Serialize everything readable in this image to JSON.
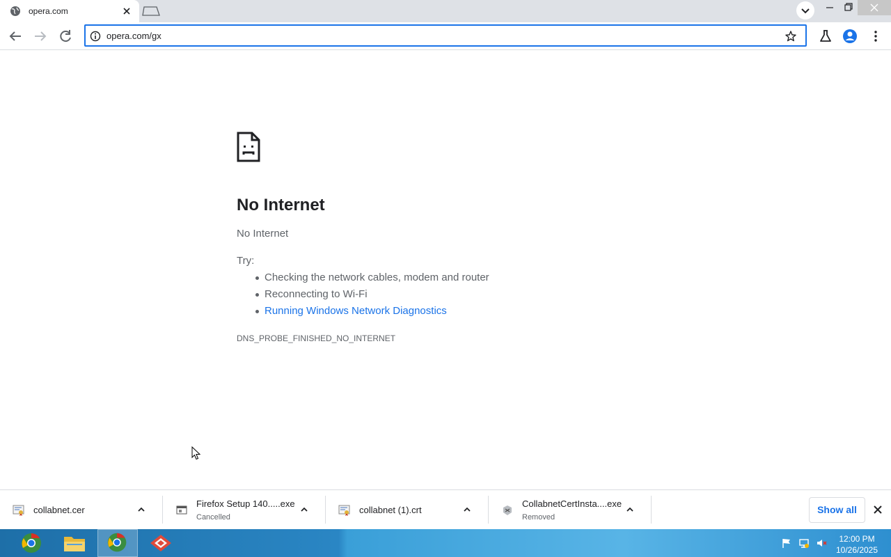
{
  "browser": {
    "tab": {
      "title": "opera.com"
    },
    "address": {
      "url": "opera.com/gx"
    }
  },
  "error_page": {
    "title": "No Internet",
    "subtitle": "No Internet",
    "try_label": "Try:",
    "suggestions": [
      "Checking the network cables, modem and router",
      "Reconnecting to Wi-Fi",
      "Running Windows Network Diagnostics"
    ],
    "error_code": "DNS_PROBE_FINISHED_NO_INTERNET"
  },
  "downloads": {
    "items": [
      {
        "name": "collabnet.cer",
        "status": ""
      },
      {
        "name": "Firefox Setup 140.....exe",
        "status": "Cancelled"
      },
      {
        "name": "collabnet (1).crt",
        "status": ""
      },
      {
        "name": "CollabnetCertInsta....exe",
        "status": "Removed"
      }
    ],
    "show_all_label": "Show all"
  },
  "taskbar": {
    "clock_time": "12:00 PM",
    "clock_date": "10/26/2025"
  },
  "colors": {
    "accent": "#1a73e8",
    "text_secondary": "#5f6368",
    "tabstrip_bg": "#dee1e6"
  }
}
